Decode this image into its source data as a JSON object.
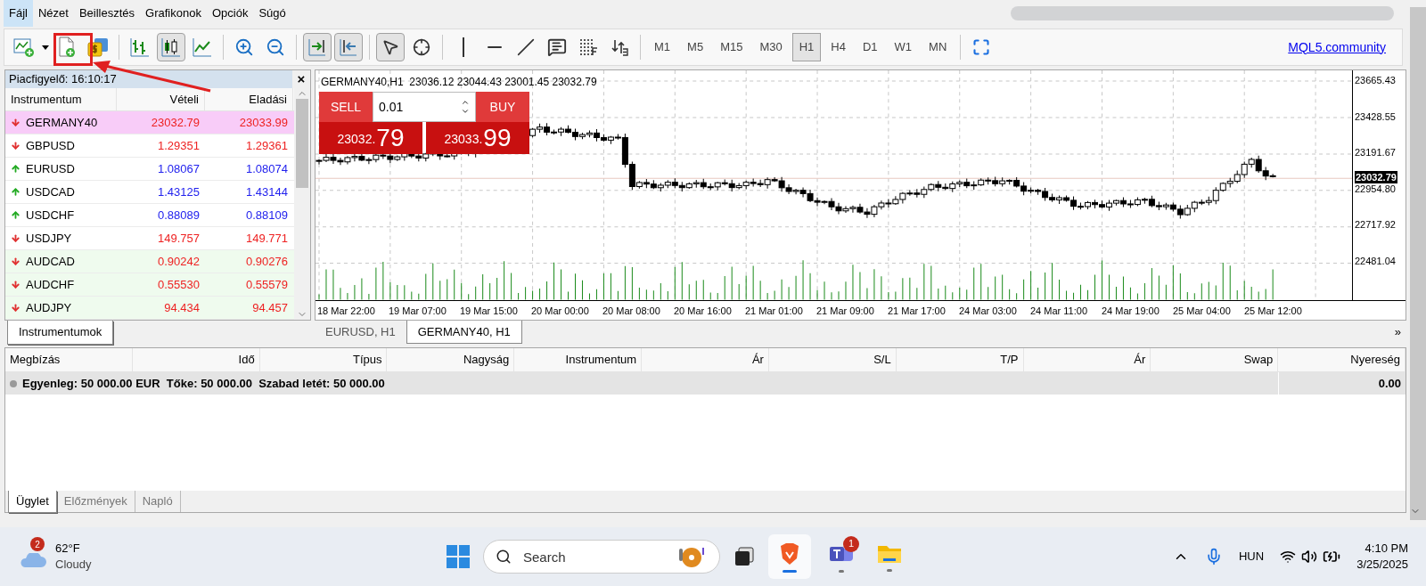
{
  "menu": [
    {
      "label": "Fájl",
      "selected": true
    },
    {
      "label": "Nézet",
      "selected": false
    },
    {
      "label": "Beillesztés",
      "selected": false
    },
    {
      "label": "Grafikonok",
      "selected": false
    },
    {
      "label": "Opciók",
      "selected": false
    },
    {
      "label": "Súgó",
      "selected": false
    }
  ],
  "toolbar": {
    "bars_selected": false,
    "candles_selected": true,
    "line_selected": false,
    "autoscroll_on": true,
    "chart_shift_on": true,
    "cursor_selected": true
  },
  "timeframes": [
    {
      "label": "M1",
      "selected": false
    },
    {
      "label": "M5",
      "selected": false
    },
    {
      "label": "M15",
      "selected": false
    },
    {
      "label": "M30",
      "selected": false
    },
    {
      "label": "H1",
      "selected": true
    },
    {
      "label": "H4",
      "selected": false
    },
    {
      "label": "D1",
      "selected": false
    },
    {
      "label": "W1",
      "selected": false
    },
    {
      "label": "MN",
      "selected": false
    }
  ],
  "community_link": "MQL5.community",
  "market_watch": {
    "title": "Piacfigyelő: 16:10:17",
    "close": "×",
    "columns": [
      "Instrumentum",
      "Vételi",
      "Eladási"
    ],
    "rows": [
      {
        "symbol": "GERMANY40",
        "bid": "23032.79",
        "ask": "23033.99",
        "rising": false,
        "color": "#f8ccf8"
      },
      {
        "symbol": "GBPUSD",
        "bid": "1.29351",
        "ask": "1.29361",
        "rising": false,
        "color": "#ffffff"
      },
      {
        "symbol": "EURUSD",
        "bid": "1.08067",
        "ask": "1.08074",
        "rising": true,
        "color": "#ffffff"
      },
      {
        "symbol": "USDCAD",
        "bid": "1.43125",
        "ask": "1.43144",
        "rising": true,
        "color": "#ffffff"
      },
      {
        "symbol": "USDCHF",
        "bid": "0.88089",
        "ask": "0.88109",
        "rising": true,
        "color": "#ffffff"
      },
      {
        "symbol": "USDJPY",
        "bid": "149.757",
        "ask": "149.771",
        "rising": false,
        "color": "#ffffff"
      },
      {
        "symbol": "AUDCAD",
        "bid": "0.90242",
        "ask": "0.90276",
        "rising": false,
        "color": "#effbee"
      },
      {
        "symbol": "AUDCHF",
        "bid": "0.55530",
        "ask": "0.55579",
        "rising": false,
        "color": "#effbee"
      },
      {
        "symbol": "AUDJPY",
        "bid": "94.434",
        "ask": "94.457",
        "rising": false,
        "color": "#effbee"
      }
    ],
    "tab": "Instrumentumok"
  },
  "chart": {
    "header": "GERMANY40,H1  23036.12 23044.43 23001.45 23032.79",
    "trade_panel": {
      "sell_label": "SELL",
      "buy_label": "BUY",
      "volume": "0.01",
      "sell_price_small": "23032.",
      "sell_price_big": "79",
      "buy_price_small": "23033.",
      "buy_price_big": "99"
    },
    "y_labels": [
      "23665.43",
      "23428.55",
      "23191.67",
      "22954.80",
      "22717.92",
      "22481.04"
    ],
    "current_price": "23032.79",
    "x_labels": [
      "18 Mar 22:00",
      "19 Mar 07:00",
      "19 Mar 15:00",
      "20 Mar 00:00",
      "20 Mar 08:00",
      "20 Mar 16:00",
      "21 Mar 01:00",
      "21 Mar 09:00",
      "21 Mar 17:00",
      "24 Mar 03:00",
      "24 Mar 11:00",
      "24 Mar 19:00",
      "25 Mar 04:00",
      "25 Mar 12:00"
    ]
  },
  "chart_tabs": [
    {
      "label": "EURUSD, H1",
      "selected": false
    },
    {
      "label": "GERMANY40, H1",
      "selected": true
    }
  ],
  "chart_tabs_more": "»",
  "terminal": {
    "columns": [
      "Megbízás",
      "Idő",
      "Típus",
      "Nagyság",
      "Instrumentum",
      "Ár",
      "S/L",
      "T/P",
      "Ár",
      "Swap",
      "Nyereség"
    ],
    "balance": "Egyenleg: 50 000.00 EUR  Tőke: 50 000.00  Szabad letét: 50 000.00",
    "profit": "0.00",
    "tabs": [
      {
        "label": "Ügylet",
        "selected": true
      },
      {
        "label": "Előzmények",
        "selected": false
      },
      {
        "label": "Napló",
        "selected": false
      }
    ]
  },
  "taskbar": {
    "weather_badge": "2",
    "temperature": "62°F",
    "condition": "Cloudy",
    "search_placeholder": "Search",
    "teams_badge": "1",
    "language": "HUN",
    "time": "4:10 PM",
    "date": "3/25/2025"
  }
}
